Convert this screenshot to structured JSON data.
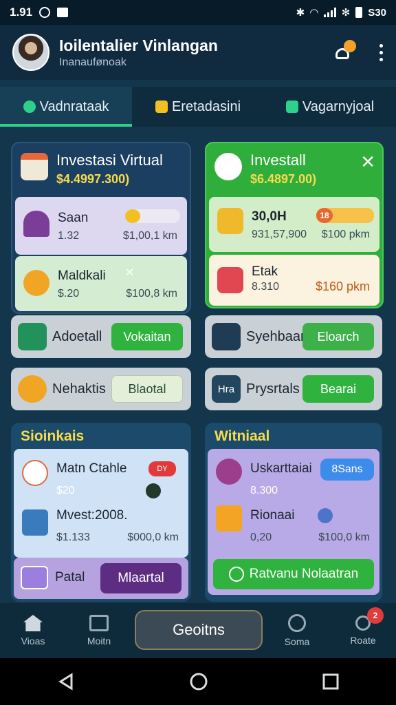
{
  "status": {
    "time": "1.91",
    "right_text": "S30"
  },
  "header": {
    "title": "Ioilentalier Vinlangan",
    "subtitle": "Inanaufønoak",
    "notif_count": ""
  },
  "tabs": [
    {
      "label": "Vadnrataak",
      "color": "#2fd08b"
    },
    {
      "label": "Eretadasini",
      "color": "#f2c022"
    },
    {
      "label": "Vagarnyjoal",
      "color": "#2fd08b"
    }
  ],
  "left_card": {
    "title": "Investasi Virtual",
    "value": "$4.4997.300)",
    "rows": [
      {
        "label": "Saan",
        "sub": "1.32",
        "right": "$1,00,1 km"
      },
      {
        "label": "Maldkali",
        "sub": "$.20",
        "right": "$100,8 km"
      }
    ]
  },
  "right_card": {
    "title": "Investall",
    "value": "$6.4897.00)",
    "rows": [
      {
        "label": "30,0H",
        "sub": "931,57,900",
        "right": "$100 pkm",
        "tag": "18"
      },
      {
        "label": "Etak",
        "sub": "8.310",
        "right": "$160 pkm"
      }
    ]
  },
  "action_rows": [
    {
      "label": "Adoetall",
      "button": "Vokaitan"
    },
    {
      "label": "Syehbaan",
      "button": "Eloarch"
    },
    {
      "label": "Nehaktis",
      "button": "Blaotal"
    },
    {
      "label": "Prysrtals",
      "button": "Bearai",
      "icon_text": "Hra"
    }
  ],
  "section_left": {
    "title": "Sioinkais",
    "rows": [
      {
        "label": "Matn Ctahle",
        "sub": "$20",
        "tag": "DY"
      },
      {
        "label": "Mvest:2008.",
        "sub": "$1.133",
        "right": "$000,0 km"
      }
    ],
    "footer_label": "Patal",
    "footer_button": "Mlaartal"
  },
  "section_right": {
    "title": "Witniaal",
    "rows": [
      {
        "label": "Uskarttaiai",
        "sub": "8.300",
        "tag": "8Sans"
      },
      {
        "label": "Rionaai",
        "sub": "0,20",
        "right": "$100,0 km"
      }
    ],
    "footer_button": "Ratvanu Nolaatran"
  },
  "bottom_nav": {
    "items": [
      "Vioas",
      "Moitn",
      "Soma",
      "Roate"
    ],
    "center_button": "Geoitns",
    "badge": "2"
  }
}
